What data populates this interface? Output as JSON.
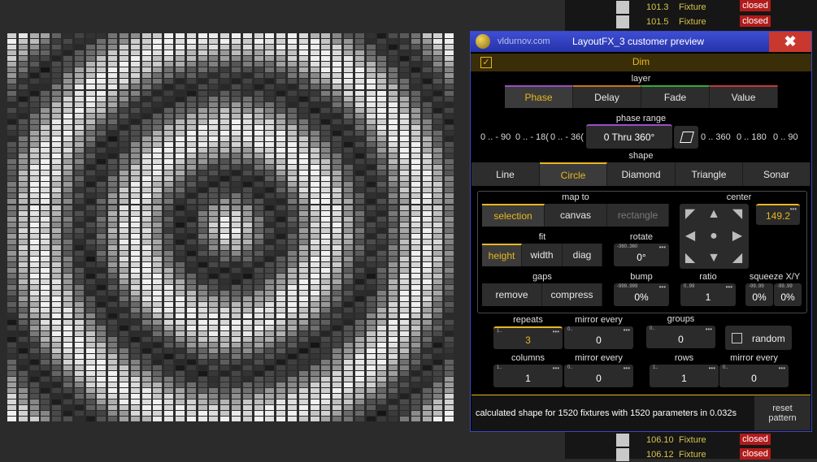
{
  "bg_rows_top": [
    {
      "num": "101.3",
      "label": "Fixture",
      "state": "closed"
    },
    {
      "num": "101.5",
      "label": "Fixture",
      "state": "closed"
    }
  ],
  "bg_rows_bottom": [
    {
      "num": "106.10",
      "label": "Fixture",
      "state": "closed"
    },
    {
      "num": "106.12",
      "label": "Fixture",
      "state": "closed"
    }
  ],
  "dialog": {
    "site": "vldurnov.com",
    "title": "LayoutFX_3 customer preview",
    "close_icon": "close-icon",
    "dim_label": "Dim",
    "dim_checked": "✓",
    "layer_label": "layer",
    "layer_tabs": [
      "Phase",
      "Delay",
      "Fade",
      "Value"
    ],
    "phase_range_label": "phase range",
    "phase_ranges_left": [
      "0 .. - 90",
      "0 .. - 18(",
      "0 .. - 36("
    ],
    "phase_range_value": "0 Thru 360°",
    "phase_ranges_right": [
      "0 .. 360",
      "0 .. 180",
      "0 .. 90"
    ],
    "shape_label": "shape",
    "shape_tabs": [
      "Line",
      "Circle",
      "Diamond",
      "Triangle",
      "Sonar"
    ],
    "map_to_label": "map to",
    "map_to_tabs": [
      "selection",
      "canvas",
      "rectangle"
    ],
    "center_label": "center",
    "center_value": "149.2",
    "fit_label": "fit",
    "fit_tabs": [
      "height",
      "width",
      "diag"
    ],
    "rotate_label": "rotate",
    "rotate_min": "-360..360",
    "rotate_value": "0°",
    "gaps_label": "gaps",
    "gaps_tabs": [
      "remove",
      "compress"
    ],
    "bump_label": "bump",
    "bump_min": "-999..999",
    "bump_value": "0%",
    "ratio_label": "ratio",
    "ratio_min": "0..99",
    "ratio_value": "1",
    "squeeze_label": "squeeze X/Y",
    "squeeze_min": "-99..99",
    "squeeze_x": "0%",
    "squeeze_y": "0%",
    "repeats_label": "repeats",
    "repeats_min": "1..",
    "repeats_value": "3",
    "mirror_every_label": "mirror every",
    "mirror_min": "0..",
    "mirror_every_value": "0",
    "groups_label": "groups",
    "groups_min": "0..",
    "groups_value": "0",
    "random_label": "random",
    "columns_label": "columns",
    "columns_min": "1..",
    "columns_value": "1",
    "mirror_every2_label": "mirror every",
    "mirror_every2_value": "0",
    "rows_label": "rows",
    "rows_min": "1..",
    "rows_value": "1",
    "mirror_every3_label": "mirror every",
    "mirror_every3_value": "0",
    "status_text": "calculated shape for  1520 fixtures with 1520 parameters in 0.032s",
    "reset_label_1": "reset",
    "reset_label_2": "pattern"
  },
  "grid": {
    "cols": 40,
    "rows": 68,
    "repeats": 3
  },
  "colors": {
    "accent": "#e7b820",
    "title_bar": "#3240c0",
    "close": "#c9382e"
  }
}
